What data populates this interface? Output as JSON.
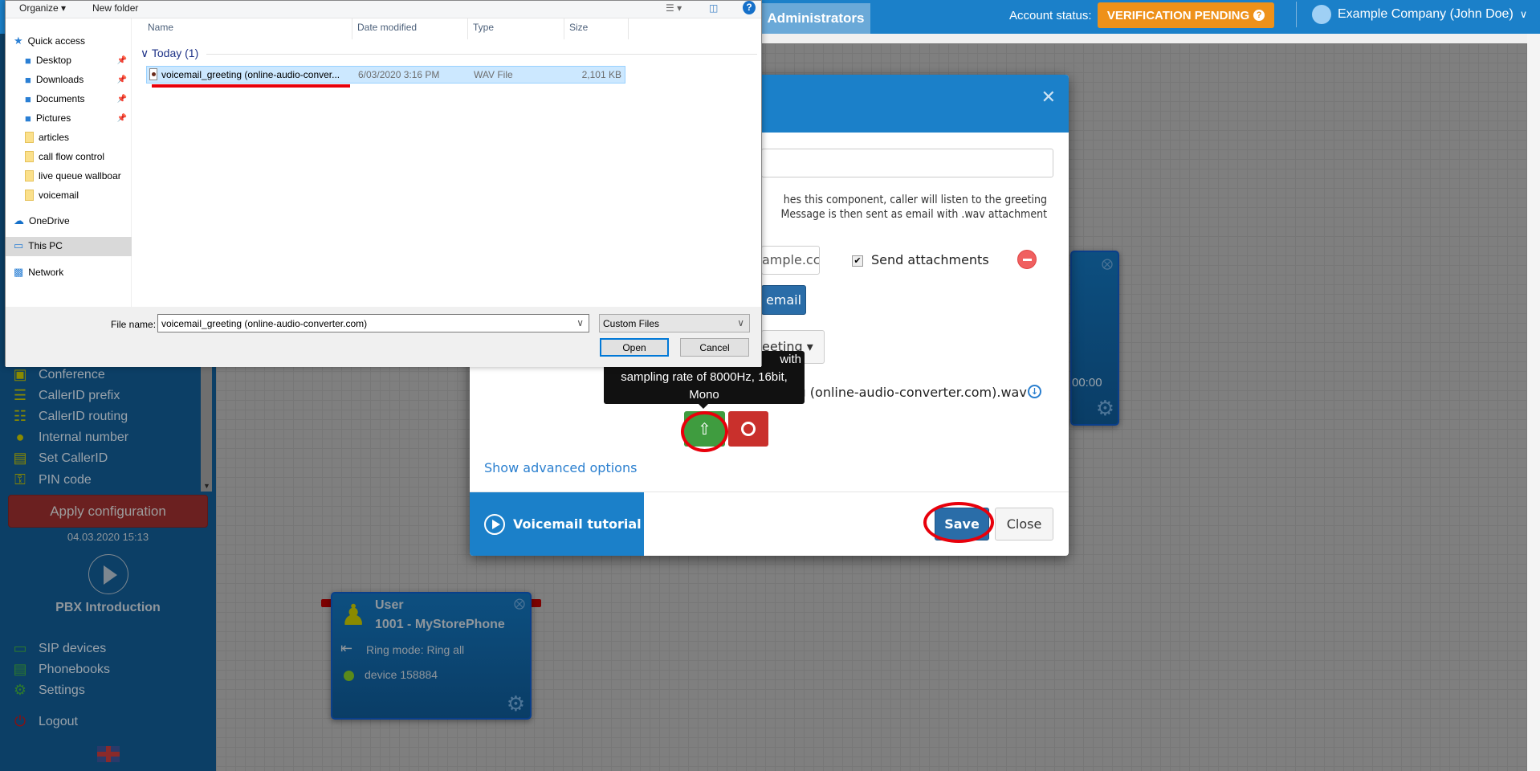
{
  "header": {
    "admin_tab": "Administrators",
    "account_status_label": "Account status:",
    "verification_badge": "VERIFICATION PENDING",
    "user_menu": "Example Company (John Doe)"
  },
  "sidebar": {
    "items": [
      {
        "label": "Conference",
        "icon": "conference-icon"
      },
      {
        "label": "CallerID prefix",
        "icon": "list-icon"
      },
      {
        "label": "CallerID routing",
        "icon": "sitemap-icon"
      },
      {
        "label": "Internal number",
        "icon": "map-marker-icon"
      },
      {
        "label": "Set CallerID",
        "icon": "id-card-icon"
      },
      {
        "label": "PIN code",
        "icon": "key-icon"
      }
    ],
    "apply_button": "Apply configuration",
    "apply_date": "04.03.2020 15:13",
    "intro_label": "PBX Introduction",
    "bottom_items": [
      {
        "label": "SIP devices",
        "icon": "monitor-icon"
      },
      {
        "label": "Phonebooks",
        "icon": "book-icon"
      },
      {
        "label": "Settings",
        "icon": "gear-icon"
      }
    ],
    "logout": "Logout"
  },
  "file_dialog": {
    "toolbar": {
      "organize": "Organize ▾",
      "new_folder": "New folder"
    },
    "columns": [
      "Name",
      "Date modified",
      "Type",
      "Size"
    ],
    "nav": [
      {
        "label": "Quick access",
        "type": "quick"
      },
      {
        "label": "Desktop",
        "type": "pinned"
      },
      {
        "label": "Downloads",
        "type": "pinned"
      },
      {
        "label": "Documents",
        "type": "pinned"
      },
      {
        "label": "Pictures",
        "type": "pinned"
      },
      {
        "label": "articles",
        "type": "folder"
      },
      {
        "label": "call flow control",
        "type": "folder"
      },
      {
        "label": "live queue wallboar",
        "type": "folder"
      },
      {
        "label": "voicemail",
        "type": "folder"
      },
      {
        "label": "OneDrive",
        "type": "cloud"
      },
      {
        "label": "This PC",
        "type": "pc",
        "selected": true
      },
      {
        "label": "Network",
        "type": "network"
      }
    ],
    "group": "Today (1)",
    "file": {
      "name": "voicemail_greeting (online-audio-conver...",
      "date": "6/03/2020 3:16 PM",
      "type": "WAV File",
      "size": "2,101 KB"
    },
    "file_name_label": "File name:",
    "file_name_value": "voicemail_greeting (online-audio-converter.com)",
    "file_type": "Custom Files",
    "open": "Open",
    "cancel": "Cancel"
  },
  "modal": {
    "description_line1": "hes this component, caller will listen to the greeting",
    "description_line2": "Message is then sent as email with .wav attachment",
    "email_partial": "ample.cc",
    "send_attachments": "Send attachments",
    "send_attachments_checked": true,
    "add_email_partial": "email",
    "greeting_dropdown_partial": "eeting",
    "tooltip": {
      "line1": "with",
      "line2": "sampling rate of 8000Hz, 16bit,",
      "line3": "Mono"
    },
    "filename": "voicemail_greeting (online-audio-converter.com).wav",
    "advanced": "Show advanced options",
    "tutorial": "Voicemail tutorial",
    "save": "Save",
    "close": "Close"
  },
  "canvas": {
    "node_right_time": "00:00",
    "user_node": {
      "type": "User",
      "name": "1001 - MyStorePhone",
      "ring_mode": "Ring mode: Ring all",
      "device": "device 158884"
    }
  },
  "colors": {
    "header": "#1b80c9",
    "verification": "#ee9119",
    "annotation": "#e8000b",
    "upload": "#3f9c3f",
    "record": "#c9302c"
  }
}
